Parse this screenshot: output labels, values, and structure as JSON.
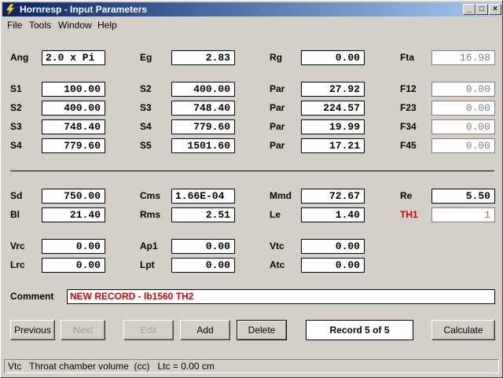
{
  "window": {
    "title": "Hornresp - Input Parameters",
    "controls": {
      "minimize": "_",
      "maximize": "□",
      "close": "×"
    }
  },
  "menu": [
    "File",
    "Tools",
    "Window",
    "Help"
  ],
  "params": {
    "ang": {
      "label": "Ang",
      "value": "2.0 x Pi"
    },
    "eg": {
      "label": "Eg",
      "value": "2.83"
    },
    "rg": {
      "label": "Rg",
      "value": "0.00"
    },
    "fta": {
      "label": "Fta",
      "value": "16.98"
    },
    "rows": [
      {
        "s_label": "S1",
        "s_value": "100.00",
        "s2_label": "S2",
        "s2_value": "400.00",
        "par_label": "Par",
        "par_value": "27.92",
        "f_label": "F12",
        "f_value": "0.00"
      },
      {
        "s_label": "S2",
        "s_value": "400.00",
        "s2_label": "S3",
        "s2_value": "748.40",
        "par_label": "Par",
        "par_value": "224.57",
        "f_label": "F23",
        "f_value": "0.00"
      },
      {
        "s_label": "S3",
        "s_value": "748.40",
        "s2_label": "S4",
        "s2_value": "779.60",
        "par_label": "Par",
        "par_value": "19.99",
        "f_label": "F34",
        "f_value": "0.00"
      },
      {
        "s_label": "S4",
        "s_value": "779.60",
        "s2_label": "S5",
        "s2_value": "1501.60",
        "par_label": "Par",
        "par_value": "17.21",
        "f_label": "F45",
        "f_value": "0.00"
      }
    ],
    "sd": {
      "label": "Sd",
      "value": "750.00"
    },
    "cms": {
      "label": "Cms",
      "value": "1.66E-04"
    },
    "mmd": {
      "label": "Mmd",
      "value": "72.67"
    },
    "re": {
      "label": "Re",
      "value": "5.50"
    },
    "bl": {
      "label": "Bl",
      "value": "21.40"
    },
    "rms": {
      "label": "Rms",
      "value": "2.51"
    },
    "le": {
      "label": "Le",
      "value": "1.40"
    },
    "th1": {
      "label": "TH1",
      "value": "1"
    },
    "vrc": {
      "label": "Vrc",
      "value": "0.00"
    },
    "ap1": {
      "label": "Ap1",
      "value": "0.00"
    },
    "vtc": {
      "label": "Vtc",
      "value": "0.00"
    },
    "lrc": {
      "label": "Lrc",
      "value": "0.00"
    },
    "lpt": {
      "label": "Lpt",
      "value": "0.00"
    },
    "atc": {
      "label": "Atc",
      "value": "0.00"
    }
  },
  "comment": {
    "label": "Comment",
    "value": "NEW RECORD - lb1560 TH2"
  },
  "buttons": {
    "previous": "Previous",
    "next": "Next",
    "edit": "Edit",
    "add": "Add",
    "delete": "Delete",
    "calculate": "Calculate"
  },
  "record": "Record 5 of 5",
  "status": "Vtc   Throat chamber volume  (cc)   Ltc = 0.00 cm",
  "colors": {
    "title_start": "#0a246a",
    "title_end": "#a6caf0",
    "comment_text": "#cc0000",
    "th1_label": "#cc0000"
  }
}
